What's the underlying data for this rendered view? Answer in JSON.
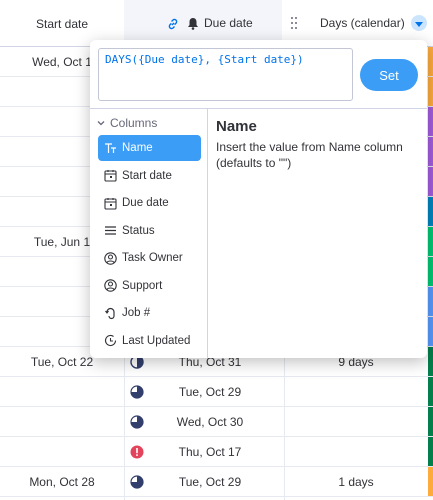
{
  "header": {
    "start_col": "Start date",
    "due_col": "Due date",
    "days_col": "Days (calendar)"
  },
  "rows": [
    {
      "start": "Wed, Oct 1",
      "due": "",
      "days": "",
      "status": "",
      "strip": "#fdab3d"
    },
    {
      "start": "",
      "due": "",
      "days": "",
      "status": "",
      "strip": "#fdab3d"
    },
    {
      "start": "",
      "due": "",
      "days": "",
      "status": "",
      "strip": "#a25ddc"
    },
    {
      "start": "",
      "due": "",
      "days": "",
      "status": "",
      "strip": "#a25ddc"
    },
    {
      "start": "",
      "due": "",
      "days": "",
      "status": "",
      "strip": "#a25ddc"
    },
    {
      "start": "",
      "due": "",
      "days": "",
      "status": "",
      "strip": "#0086c0"
    },
    {
      "start": "Tue, Jun 1",
      "due": "",
      "days": "",
      "status": "",
      "strip": "#00c875"
    },
    {
      "start": "",
      "due": "",
      "days": "",
      "status": "",
      "strip": "#00c875"
    },
    {
      "start": "",
      "due": "",
      "days": "",
      "status": "",
      "strip": "#579bfc"
    },
    {
      "start": "",
      "due": "",
      "days": "",
      "status": "",
      "strip": "#579bfc"
    },
    {
      "start": "Tue, Oct 22",
      "due": "Thu, Oct 31",
      "days": "9 days",
      "status": "half",
      "strip": "#037f4c"
    },
    {
      "start": "",
      "due": "Tue, Oct 29",
      "days": "",
      "status": "three-quarter",
      "strip": "#037f4c"
    },
    {
      "start": "",
      "due": "Wed, Oct 30",
      "days": "",
      "status": "three-quarter",
      "strip": "#037f4c"
    },
    {
      "start": "",
      "due": "Thu, Oct 17",
      "days": "",
      "status": "alert",
      "strip": "#037f4c"
    },
    {
      "start": "Mon, Oct 28",
      "due": "Tue, Oct 29",
      "days": "1 days",
      "status": "three-quarter",
      "strip": "#fdab3d"
    }
  ],
  "popup": {
    "formula": "DAYS({Due date}, {Start date})",
    "set_label": "Set",
    "columns_header": "Columns",
    "columns": [
      {
        "label": "Name",
        "icon": "text-icon",
        "selected": true
      },
      {
        "label": "Start date",
        "icon": "calendar-icon",
        "selected": false
      },
      {
        "label": "Due date",
        "icon": "calendar-icon",
        "selected": false
      },
      {
        "label": "Status",
        "icon": "lines-icon",
        "selected": false
      },
      {
        "label": "Task Owner",
        "icon": "person-icon",
        "selected": false
      },
      {
        "label": "Support",
        "icon": "person-icon",
        "selected": false
      },
      {
        "label": "Job #",
        "icon": "hook-icon",
        "selected": false
      },
      {
        "label": "Last Updated",
        "icon": "clock-icon",
        "selected": false
      }
    ],
    "detail": {
      "title": "Name",
      "text": "Insert the value from Name column (defaults to \"\")"
    }
  },
  "colors": {
    "accent": "#3b9df6",
    "formula_text": "#0073ea",
    "status_dark": "#323e6b",
    "alert": "#e2445c"
  }
}
